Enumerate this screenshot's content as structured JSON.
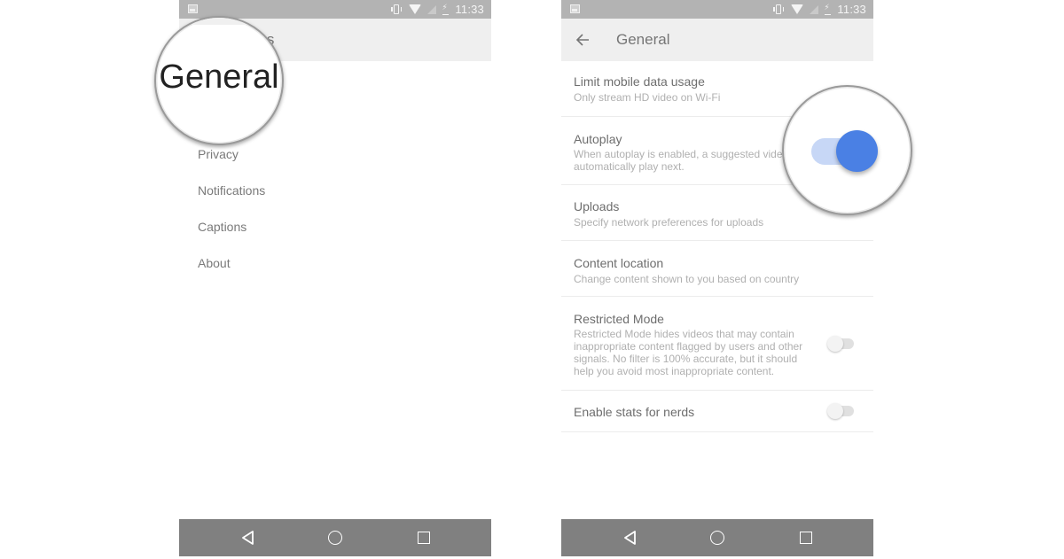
{
  "status_bar": {
    "time": "11:33",
    "icons": [
      "image-icon",
      "vibrate-icon",
      "wifi-icon",
      "no-signal-icon",
      "battery-charging-icon"
    ]
  },
  "left_screen": {
    "toolbar_title": "Settings",
    "toolbar_title_visible": "ngs",
    "magnified_label": "General",
    "menu_items": [
      {
        "label": "General"
      },
      {
        "label": "Privacy"
      },
      {
        "label": "Notifications"
      },
      {
        "label": "Captions"
      },
      {
        "label": "About"
      }
    ]
  },
  "right_screen": {
    "toolbar_title": "General",
    "back_icon": "arrow-left-icon",
    "settings": [
      {
        "title": "Limit mobile data usage",
        "subtitle": "Only stream HD video on Wi-Fi",
        "has_toggle": true,
        "enabled": false
      },
      {
        "title": "Autoplay",
        "subtitle": "When autoplay is enabled, a suggested video will automatically play next.",
        "subtitle_visible_lines": [
          "When autoplay is enabled, a suggested vide",
          "automatically play next."
        ],
        "has_toggle": true,
        "enabled": true
      },
      {
        "title": "Uploads",
        "subtitle": "Specify network preferences for uploads",
        "has_toggle": false
      },
      {
        "title": "Content location",
        "subtitle": "Change content shown to you based on country",
        "has_toggle": false
      },
      {
        "title": "Restricted Mode",
        "subtitle": "Restricted Mode hides videos that may contain inappropriate content flagged by users and other signals. No filter is 100% accurate, but it should help you avoid most inappropriate content.",
        "has_toggle": true,
        "enabled": false
      },
      {
        "title": "Enable stats for nerds",
        "subtitle": "",
        "has_toggle": true,
        "enabled": false
      }
    ]
  },
  "nav_bar": {
    "buttons": [
      "back-icon",
      "home-icon",
      "recents-icon"
    ]
  },
  "colors": {
    "status_bar": "#b3b3b3",
    "toolbar": "#efefef",
    "nav_bar": "#808080",
    "toggle_on_knob": "#4a80e4",
    "toggle_on_track": "#c7d7f6",
    "toggle_off_track": "#e0e0e0"
  }
}
